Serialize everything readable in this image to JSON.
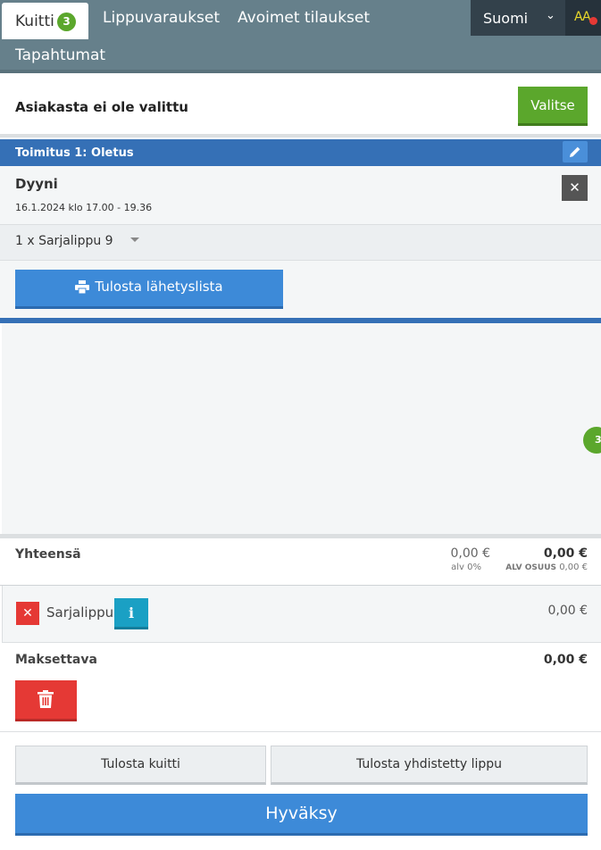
{
  "nav": {
    "tabs": [
      {
        "label": "Kuitti",
        "badge": "3"
      },
      {
        "label": "Lippuvaraukset"
      },
      {
        "label": "Avoimet tilaukset"
      },
      {
        "label": "Tapahtumat"
      }
    ],
    "language": "Suomi",
    "accessibility_label": "AA"
  },
  "customer": {
    "label": "Asiakasta ei ole valittu",
    "select_button": "Valitse"
  },
  "delivery": {
    "title": "Toimitus 1: Oletus"
  },
  "event": {
    "name": "Dyyni",
    "time": "16.1.2024 klo 17.00 - 19.36",
    "ticket": "1 x Sarjalippu 9",
    "print_button": "Tulosta lähetyslista"
  },
  "side_badge": "3",
  "totals": {
    "label": "Yhteensä",
    "net": "0,00 €",
    "vat": "alv 0%",
    "gross": "0,00 €",
    "vat_share_label": "ALV OSUUS",
    "vat_share_value": "0,00 €"
  },
  "payment": {
    "name": "Sarjalippu",
    "amount": "0,00 €"
  },
  "payable": {
    "label": "Maksettava",
    "amount": "0,00 €"
  },
  "actions": {
    "print_receipt": "Tulosta kuitti",
    "print_combined": "Tulosta yhdistetty lippu",
    "accept": "Hyväksy"
  },
  "colors": {
    "nav_bg": "#66808b",
    "accent_green": "#5ba72c",
    "accent_blue": "#3d8ad8",
    "delivery_blue": "#3570b6",
    "danger_red": "#e53935",
    "info_teal": "#1aa0c4"
  }
}
